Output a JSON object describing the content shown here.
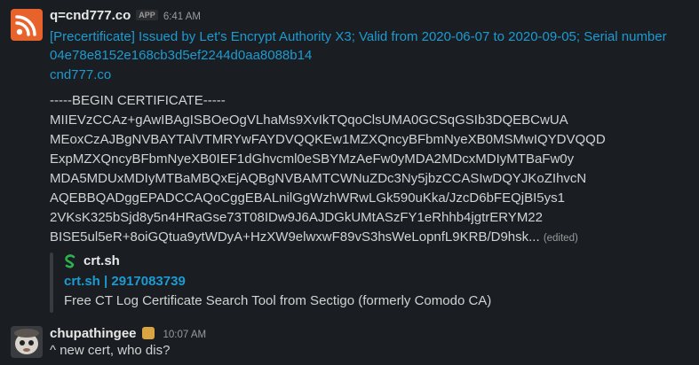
{
  "message1": {
    "sender": "q=cnd777.co",
    "badge": "APP",
    "time": "6:41 AM",
    "link_line1": "[Precertificate] Issued by Let's Encrypt Authority X3; Valid from 2020-06-07 to 2020-09-05; Serial number",
    "link_line2": "04e78e8152e168cb3d5ef2244d0aa8088b14",
    "domain_link": "cnd777.co",
    "cert_lines": [
      "-----BEGIN CERTIFICATE-----",
      "MIIEVzCCAz+gAwIBAgISBOeOgVLhaMs9XvIkTQqoClsUMA0GCSqGSIb3DQEBCwUA",
      "MEoxCzAJBgNVBAYTAlVTMRYwFAYDVQQKEw1MZXQncyBFbmNyeXB0MSMwIQYDVQQD",
      "ExpMZXQncyBFbmNyeXB0IEF1dGhvcml0eSBYMzAeFw0yMDA2MDcxMDIyMTBaFw0y",
      "MDA5MDUxMDIyMTBaMBQxEjAQBgNVBAMTCWNuZDc3Ny5jbzCCASIwDQYJKoZIhvcN",
      "AQEBBQADggEPADCCAQoCggEBALnilGgWzhWRwLGk590uKka/JzcD6bFEQjBI5ys1",
      "2VKsK325bSjd8y5n4HRaGse73T08IDw9J6AJDGkUMtASzFY1eRhhb4jgtrERYM22",
      "BISE5ul5eR+8oiGQtua9ytWDyA+HzXW9elwxwF89vS3hsWeLopnfL9KRB/D9hsk..."
    ],
    "edited": "(edited)",
    "attachment": {
      "site": "crt.sh",
      "title": "crt.sh | 2917083739",
      "description": "Free CT Log Certificate Search Tool from Sectigo (formerly Comodo CA)"
    }
  },
  "message2": {
    "sender": "chupathingee",
    "time": "10:07 AM",
    "text": "^ new cert, who dis?"
  }
}
